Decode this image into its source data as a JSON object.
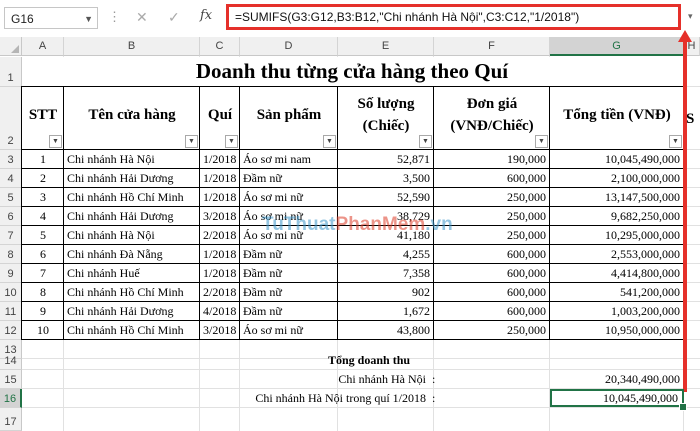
{
  "formula_bar": {
    "name_box": "G16",
    "cancel_icon": "✕",
    "enter_icon": "✓",
    "fx_label": "fx",
    "formula": "=SUMIFS(G3:G12,B3:B12,\"Chi nhánh Hà Nội\",C3:C12,\"1/2018\")"
  },
  "columns": [
    "A",
    "B",
    "C",
    "D",
    "E",
    "F",
    "G",
    "H"
  ],
  "rows": [
    "1",
    "2",
    "3",
    "4",
    "5",
    "6",
    "7",
    "8",
    "9",
    "10",
    "11",
    "12",
    "13",
    "14",
    "15",
    "16",
    "17"
  ],
  "title": "Doanh thu từng cửa hàng theo Quí",
  "headers": {
    "stt": "STT",
    "store": "Tên cửa hàng",
    "quarter": "Quí",
    "product": "Sản phẩm",
    "qty": "Số lượng (Chiếc)",
    "price": "Đơn giá (VNĐ/Chiếc)",
    "total": "Tổng tiền (VNĐ)",
    "overflow": "S"
  },
  "table": [
    [
      "1",
      "Chi nhánh Hà Nội",
      "1/2018",
      "Áo sơ mi nam",
      "52,871",
      "190,000",
      "10,045,490,000"
    ],
    [
      "2",
      "Chi nhánh Hải Dương",
      "1/2018",
      "Đầm nữ",
      "3,500",
      "600,000",
      "2,100,000,000"
    ],
    [
      "3",
      "Chi nhánh Hồ Chí Minh",
      "1/2018",
      "Áo sơ mi nữ",
      "52,590",
      "250,000",
      "13,147,500,000"
    ],
    [
      "4",
      "Chi nhánh Hải Dương",
      "3/2018",
      "Áo sơ mi nữ",
      "38,729",
      "250,000",
      "9,682,250,000"
    ],
    [
      "5",
      "Chi nhánh Hà Nội",
      "2/2018",
      "Áo sơ mi nữ",
      "41,180",
      "250,000",
      "10,295,000,000"
    ],
    [
      "6",
      "Chi nhánh Đà Nẵng",
      "1/2018",
      "Đầm nữ",
      "4,255",
      "600,000",
      "2,553,000,000"
    ],
    [
      "7",
      "Chi nhánh Huế",
      "1/2018",
      "Đầm nữ",
      "7,358",
      "600,000",
      "4,414,800,000"
    ],
    [
      "8",
      "Chi nhánh Hồ Chí Minh",
      "2/2018",
      "Đầm nữ",
      "902",
      "600,000",
      "541,200,000"
    ],
    [
      "9",
      "Chi nhánh Hải Dương",
      "4/2018",
      "Đầm nữ",
      "1,672",
      "600,000",
      "1,003,200,000"
    ],
    [
      "10",
      "Chi nhánh Hồ Chí Minh",
      "3/2018",
      "Áo sơ mi nữ",
      "43,800",
      "250,000",
      "10,950,000,000"
    ]
  ],
  "summary": {
    "heading": "Tổng doanh thu",
    "label1": "Chi nhánh Hà Nội",
    "colon1": ":",
    "value1": "20,340,490,000",
    "label2": "Chi nhánh Hà Nội trong quí 1/2018",
    "colon2": ":",
    "value2": "10,045,490,000"
  },
  "watermark": {
    "part1": "TuThuat",
    "part2": "PhanMem",
    "part3": ".vn"
  },
  "colors": {
    "highlight": "#e5302a",
    "selection": "#217346"
  }
}
